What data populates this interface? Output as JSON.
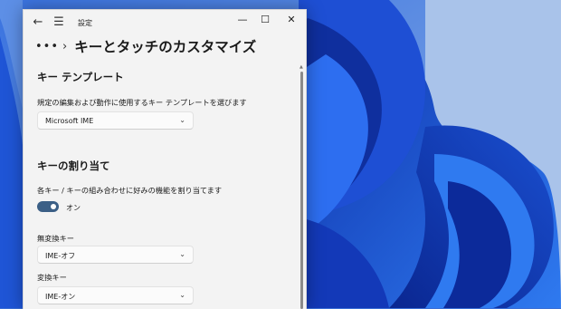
{
  "window": {
    "app_title": "設定",
    "back_icon": "back-arrow-icon",
    "menu_icon": "hamburger-menu-icon",
    "minimize_icon": "minimize-icon",
    "maximize_icon": "maximize-icon",
    "close_icon": "close-icon"
  },
  "header": {
    "more_label": "•••",
    "title": "キーとタッチのカスタマイズ"
  },
  "key_template": {
    "title": "キー テンプレート",
    "description": "規定の編集および動作に使用するキー テンプレートを選びます",
    "selected": "Microsoft IME"
  },
  "key_assign": {
    "title": "キーの割り当て",
    "description": "各キー / キーの組み合わせに好みの機能を割り当てます",
    "toggle_label": "オン",
    "toggle_on": true,
    "muhenkan_label": "無変換キー",
    "muhenkan_value": "IME-オフ",
    "henkan_label": "変換キー",
    "henkan_value": "IME-オン"
  },
  "colors": {
    "accent": "#3b5f86",
    "window_bg": "#f3f3f3",
    "wallpaper": "#2f63d8"
  }
}
